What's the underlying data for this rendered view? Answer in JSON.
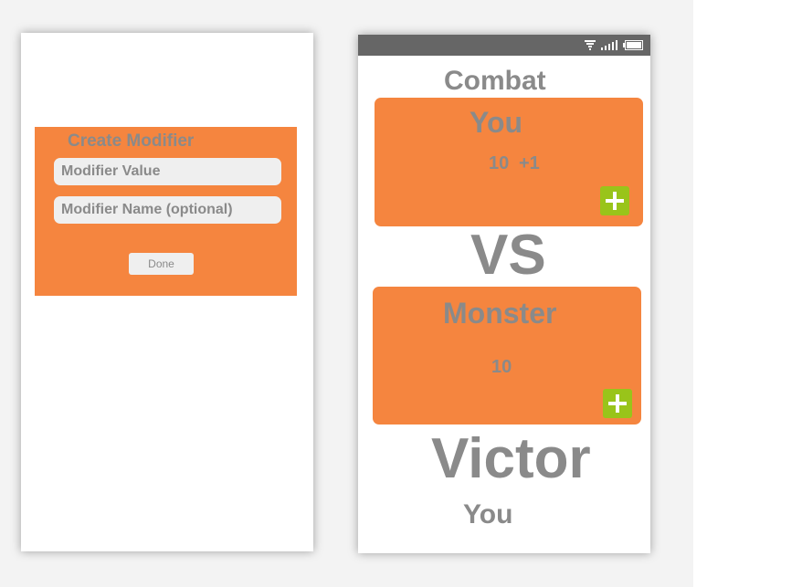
{
  "modifier_dialog": {
    "title": "Create Modifier",
    "value_placeholder": "Modifier Value",
    "name_placeholder": "Modifier Name (optional)",
    "done_label": "Done"
  },
  "combat_screen": {
    "title": "Combat",
    "player": {
      "name": "You",
      "base": "10",
      "modifier": "+1"
    },
    "vs_label": "VS",
    "monster": {
      "name": "Monster",
      "base": "10"
    },
    "victor_label": "Victor",
    "victor_name": "You"
  },
  "colors": {
    "card_orange": "#f5853f",
    "plus_green": "#99c41a",
    "text_gray": "#8a8a8a",
    "status_bar": "#666666"
  },
  "icons": [
    "wifi-icon",
    "signal-icon",
    "battery-icon",
    "plus-icon"
  ]
}
